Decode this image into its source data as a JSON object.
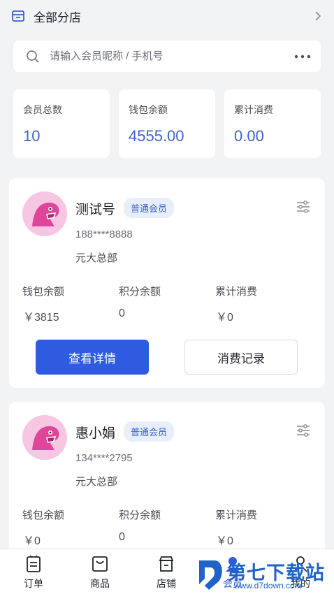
{
  "header": {
    "store_label": "全部分店"
  },
  "search": {
    "placeholder": "请输入会员昵称 / 手机号"
  },
  "stats": [
    {
      "label": "会员总数",
      "value": "10"
    },
    {
      "label": "钱包余额",
      "value": "4555.00"
    },
    {
      "label": "累计消费",
      "value": "0.00"
    }
  ],
  "members": [
    {
      "name": "测试号",
      "level": "普通会员",
      "phone": "188****8888",
      "branch": "元大总部",
      "wallet_label": "钱包余额",
      "wallet": "￥3815",
      "points_label": "积分余额",
      "points": "0",
      "spent_label": "累计消费",
      "spent": "￥0",
      "detail_button": "查看详情",
      "records_button": "消费记录"
    },
    {
      "name": "惠小娟",
      "level": "普通会员",
      "phone": "134****2795",
      "branch": "元大总部",
      "wallet_label": "钱包余额",
      "wallet": "￥0",
      "points_label": "积分余额",
      "points": "0",
      "spent_label": "累计消费",
      "spent": "￥0"
    }
  ],
  "tabbar": {
    "items": [
      {
        "label": "订单",
        "icon": "order-icon"
      },
      {
        "label": "商品",
        "icon": "goods-icon"
      },
      {
        "label": "店铺",
        "icon": "store-icon"
      },
      {
        "label": "会员",
        "icon": "member-icon"
      },
      {
        "label": "我的",
        "icon": "profile-icon"
      }
    ]
  },
  "watermark": {
    "text": "第七下载站",
    "url": "www.d7down.com"
  },
  "colors": {
    "accent": "#2f5be1",
    "value_blue": "#3d63c8",
    "badge_bg": "#e8eefc",
    "page_bg": "#f2f3f5"
  }
}
